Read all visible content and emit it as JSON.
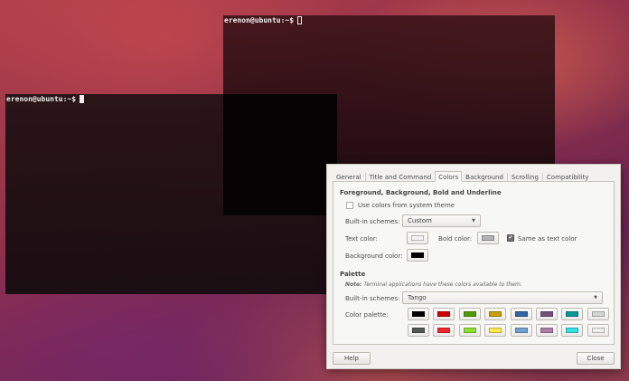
{
  "terminal_back": {
    "prompt": "erenon@ubuntu:~$"
  },
  "terminal_front": {
    "prompt": "erenon@ubuntu:~$"
  },
  "prefs": {
    "tabs": [
      "General",
      "Title and Command",
      "Colors",
      "Background",
      "Scrolling",
      "Compatibility"
    ],
    "active_tab": "Colors",
    "fg_section": {
      "title": "Foreground, Background, Bold and Underline",
      "use_system_theme": {
        "label": "Use colors from system theme",
        "checked": false
      },
      "builtin_label": "Built-in schemes:",
      "builtin_value": "Custom",
      "text_color_label": "Text color:",
      "text_color": "#f2f2f2",
      "bold_color_label": "Bold color:",
      "bold_color": "#b4b4b4",
      "same_as_text": {
        "label": "Same as text color",
        "checked": true
      },
      "bg_color_label": "Background color:",
      "bg_color": "#000000"
    },
    "palette_section": {
      "title": "Palette",
      "note_bold": "Note:",
      "note_text": " Terminal applications have these colors available to them.",
      "builtin_label": "Built-in schemes:",
      "builtin_value": "Tango",
      "palette_label": "Color palette:",
      "colors_row1": [
        "#000000",
        "#cc0000",
        "#4e9a06",
        "#c4a000",
        "#3465a4",
        "#75507b",
        "#06989a",
        "#d3d7cf"
      ],
      "colors_row2": [
        "#555753",
        "#ef2929",
        "#8ae234",
        "#fce94f",
        "#729fcf",
        "#ad7fa8",
        "#34e2e2",
        "#eeeeec"
      ]
    },
    "help_label": "Help",
    "close_label": "Close"
  }
}
